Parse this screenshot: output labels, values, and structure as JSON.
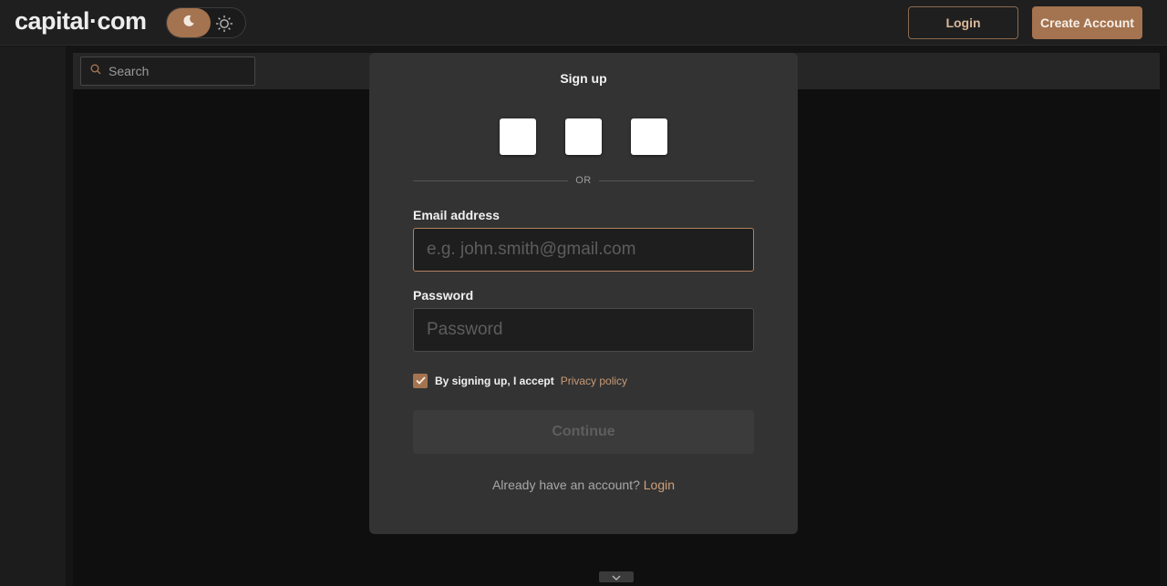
{
  "header": {
    "logo": "capital·com",
    "theme_toggle": {
      "active": "dark",
      "dark_icon": "moon-icon",
      "light_icon": "sun-icon"
    },
    "login_label": "Login",
    "create_account_label": "Create Account"
  },
  "search": {
    "placeholder": "Search",
    "icon": "search-icon"
  },
  "modal": {
    "title": "Sign up",
    "social_buttons": [
      "social-button-1",
      "social-button-2",
      "social-button-3"
    ],
    "divider_text": "OR",
    "email": {
      "label": "Email address",
      "placeholder": "e.g. john.smith@gmail.com",
      "value": ""
    },
    "password": {
      "label": "Password",
      "placeholder": "Password",
      "value": ""
    },
    "consent": {
      "checked": true,
      "text": "By signing up, I accept",
      "link": "Privacy policy"
    },
    "continue_label": "Continue",
    "footer": {
      "text": "Already have an account?",
      "link": "Login"
    }
  },
  "colors": {
    "accent": "#a4734f",
    "accent_text": "#d2a07a",
    "background": "#141414",
    "modal_bg": "#333333"
  }
}
